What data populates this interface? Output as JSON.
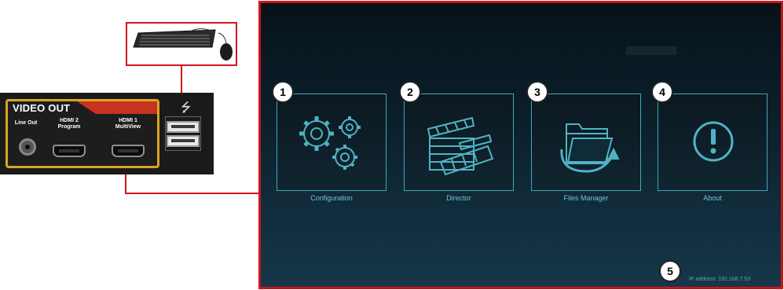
{
  "hardware_panel": {
    "section_title": "VIDEO OUT",
    "ports": {
      "line_out": "Line Out",
      "hdmi2_line1": "HDMI 2",
      "hdmi2_line2": "Program",
      "hdmi1_line1": "HDMI 1",
      "hdmi1_line2": "MultiView"
    },
    "usb_symbol": "⭍"
  },
  "screen": {
    "tiles": [
      {
        "badge": "1",
        "label": "Configuration",
        "icon": "gears-icon"
      },
      {
        "badge": "2",
        "label": "Director",
        "icon": "clapperboard-icon"
      },
      {
        "badge": "3",
        "label": "Files Manager",
        "icon": "folder-icon"
      },
      {
        "badge": "4",
        "label": "About",
        "icon": "info-exclamation-icon"
      }
    ],
    "ip_badge": "5",
    "ip_address": "IP address: 192.168.7.53"
  },
  "colors": {
    "highlight_red": "#d0141a",
    "tile_border": "#3fa8ba",
    "label_cyan": "#6fc6d6",
    "panel_gold": "#d9a520"
  }
}
